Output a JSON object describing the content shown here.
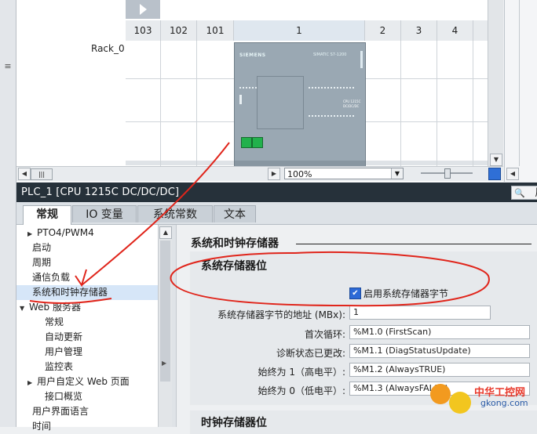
{
  "device_view": {
    "rack_label": "Rack_0",
    "slots": [
      "103",
      "102",
      "101",
      "1",
      "2",
      "3",
      "4"
    ],
    "cpu_brand": "SIEMENS",
    "cpu_model": "SIMATIC S7-1200",
    "cpu_face_label": "CPU 1215C DC/DC/DC",
    "zoom": "100%"
  },
  "properties": {
    "title": "PLC_1 [CPU 1215C DC/DC/DC]",
    "side_tab": "属",
    "tabs": [
      "常规",
      "IO 变量",
      "系统常数",
      "文本"
    ]
  },
  "nav": {
    "items": [
      {
        "label": "PTO4/PWM4",
        "caret": "▶",
        "indent": 1,
        "selected": false
      },
      {
        "label": "启动",
        "caret": "",
        "indent": 0,
        "selected": false
      },
      {
        "label": "周期",
        "caret": "",
        "indent": 0,
        "selected": false
      },
      {
        "label": "通信负载",
        "caret": "",
        "indent": 0,
        "selected": false
      },
      {
        "label": "系统和时钟存储器",
        "caret": "",
        "indent": 0,
        "selected": true
      },
      {
        "label": "Web 服务器",
        "caret": "▼",
        "indent": 0,
        "selected": false
      },
      {
        "label": "常规",
        "caret": "",
        "indent": 2,
        "selected": false
      },
      {
        "label": "自动更新",
        "caret": "",
        "indent": 2,
        "selected": false
      },
      {
        "label": "用户管理",
        "caret": "",
        "indent": 2,
        "selected": false
      },
      {
        "label": "监控表",
        "caret": "",
        "indent": 2,
        "selected": false
      },
      {
        "label": "用户自定义 Web 页面",
        "caret": "▶",
        "indent": 1,
        "selected": false
      },
      {
        "label": "接口概览",
        "caret": "",
        "indent": 2,
        "selected": false
      },
      {
        "label": "用户界面语言",
        "caret": "",
        "indent": 0,
        "selected": false
      },
      {
        "label": "时间",
        "caret": "",
        "indent": 0,
        "selected": false
      }
    ]
  },
  "content": {
    "section_title": "系统和时钟存储器",
    "sys_title": "系统存储器位",
    "enable_label": "启用系统存储器字节",
    "enable_checked": true,
    "address_label": "系统存储器字节的地址 (MBx):",
    "address_value": "1",
    "rows": [
      {
        "label": "首次循环:",
        "value": "%M1.0 (FirstScan)"
      },
      {
        "label": "诊断状态已更改:",
        "value": "%M1.1 (DiagStatusUpdate)"
      },
      {
        "label": "始终为 1（高电平）:",
        "value": "%M1.2 (AlwaysTRUE)"
      },
      {
        "label": "始终为 0（低电平）:",
        "value": "%M1.3 (AlwaysFALSE)"
      }
    ],
    "clock_title": "时钟存储器位"
  },
  "watermark": {
    "name": "中华工控网",
    "domain": "gkong.com"
  },
  "colors": {
    "title_bar": "#26313a",
    "annotation": "#e0251b",
    "checkbox": "#2d6ad6",
    "cpu_body": "#9aa8b3",
    "port": "#22b14c"
  }
}
